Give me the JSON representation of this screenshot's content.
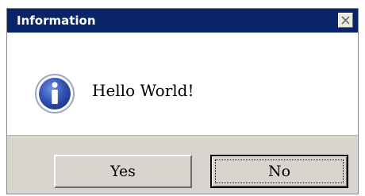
{
  "dialog": {
    "title": "Information",
    "message": "Hello World!",
    "icon": "info-icon",
    "close_icon": "close-icon",
    "buttons": {
      "yes_label": "Yes",
      "no_label": "No"
    },
    "colors": {
      "titlebar": "#0a246a",
      "title_text": "#ffffff",
      "window_bg": "#d8d4ce",
      "content_bg": "#ffffff",
      "icon_blue": "#2f4fb0"
    }
  }
}
